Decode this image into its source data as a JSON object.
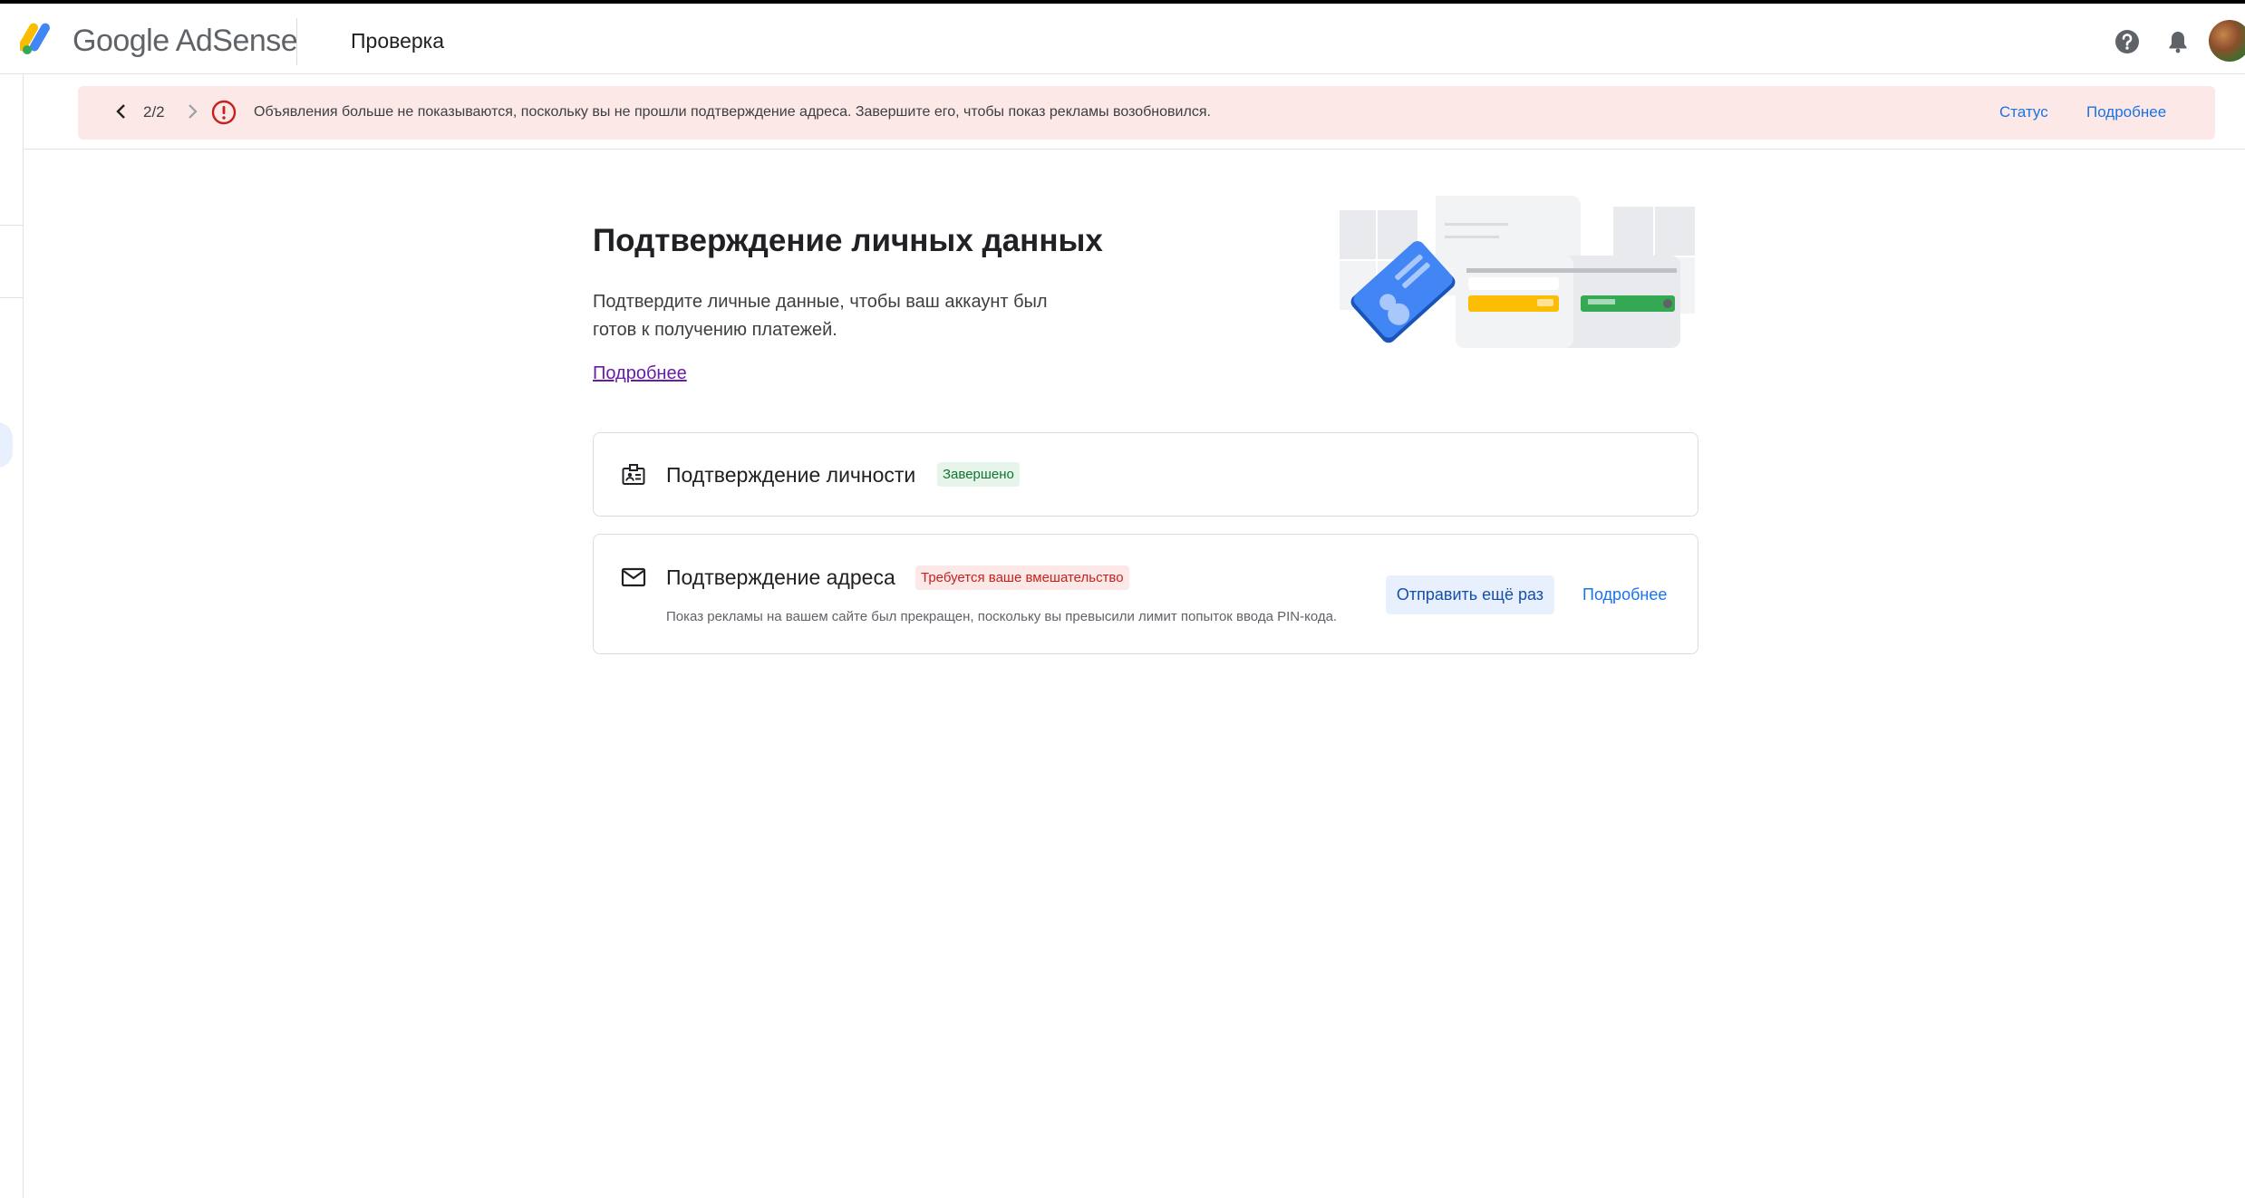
{
  "header": {
    "brand": "Google AdSense",
    "page_title": "Проверка"
  },
  "alert": {
    "counter": "2/2",
    "message": "Объявления больше не показываются, поскольку вы не прошли подтверждение адреса. Завершите его, чтобы показ рекламы возобновился.",
    "status_link": "Статус",
    "more_link": "Подробнее"
  },
  "main": {
    "title": "Подтверждение личных данных",
    "description": "Подтвердите личные данные, чтобы ваш аккаунт был готов к получению платежей.",
    "learn_more": "Подробнее"
  },
  "identity_card": {
    "icon": "badge-icon",
    "title": "Подтверждение личности",
    "status": "Завершено"
  },
  "address_card": {
    "icon": "mail-icon",
    "title": "Подтверждение адреса",
    "status": "Требуется ваше вмешательство",
    "note": "Показ рекламы на вашем сайте был прекращен, поскольку вы превысили лимит попыток ввода PIN-кода.",
    "resend_button": "Отправить ещё раз",
    "more_button": "Подробнее"
  },
  "colors": {
    "link": "#1a73e8",
    "alert_bg": "#fce8e6",
    "error": "#c5221f",
    "success_bg": "#e6f4ea",
    "success_text": "#137333"
  }
}
